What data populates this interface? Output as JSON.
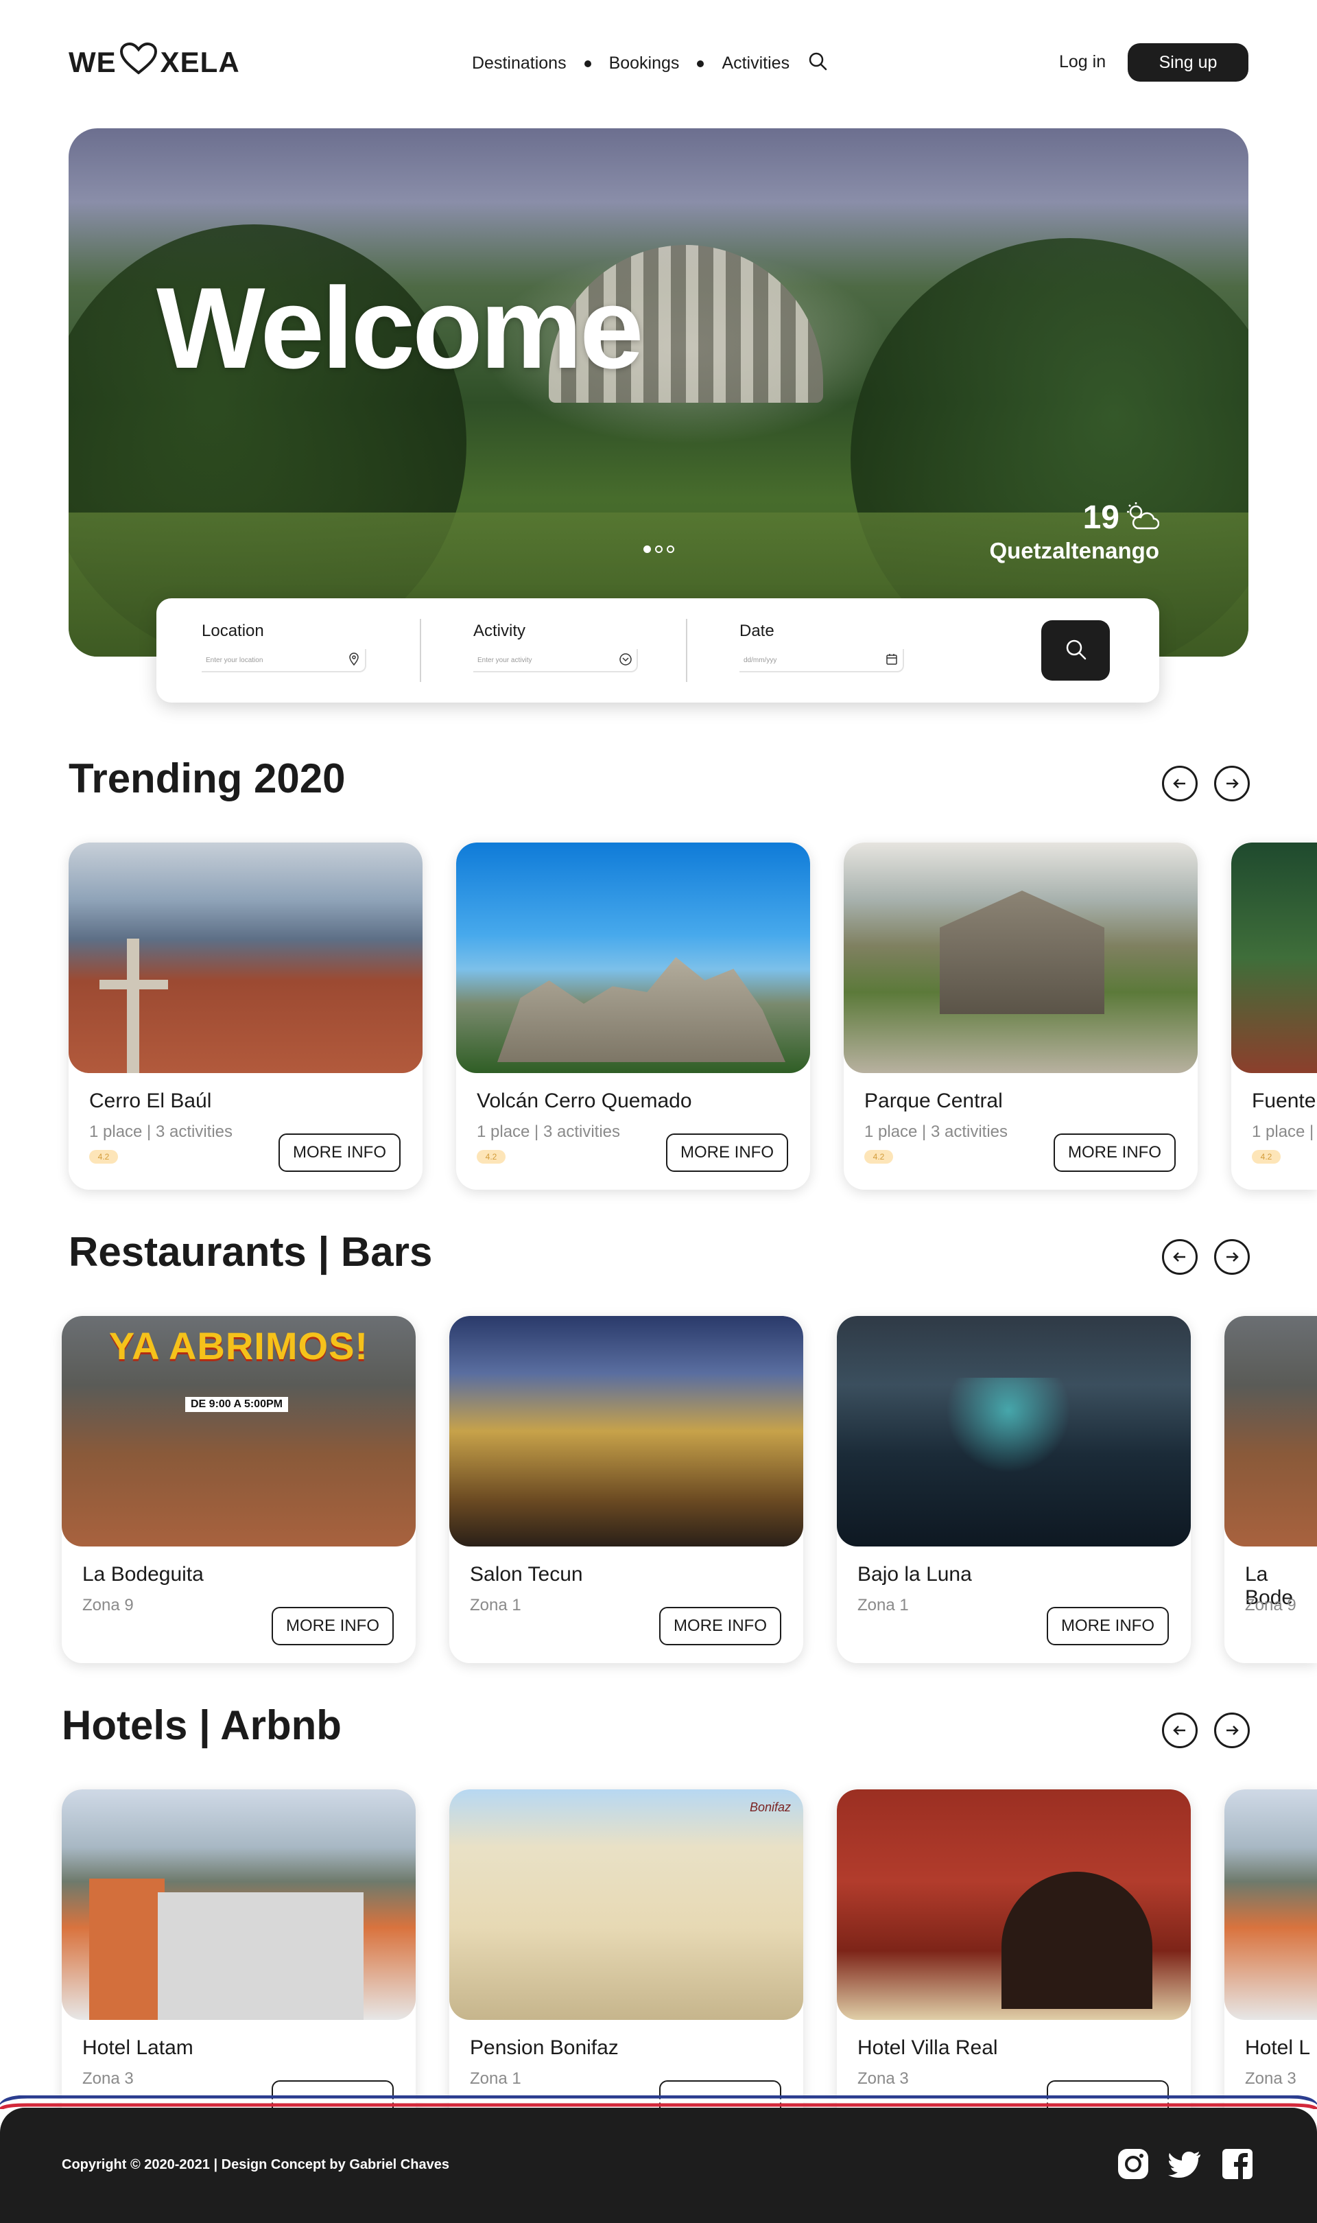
{
  "brand": {
    "prefix": "WE",
    "suffix": "XELA"
  },
  "nav": {
    "items": [
      "Destinations",
      "Bookings",
      "Activities"
    ]
  },
  "auth": {
    "login": "Log in",
    "signup": "Sing up"
  },
  "hero": {
    "title": "Welcome",
    "temperature": "19",
    "city": "Quetzaltenango",
    "slides": 3,
    "active_slide": 1
  },
  "search": {
    "location": {
      "label": "Location",
      "placeholder": "Enter your location"
    },
    "activity": {
      "label": "Activity",
      "placeholder": "Enter your activity"
    },
    "date": {
      "label": "Date",
      "placeholder": "dd/mm/yyy"
    }
  },
  "trending": {
    "title": "Trending 2020",
    "cards": [
      {
        "title": "Cerro El Baúl",
        "sub": "1 place | 3 activities",
        "rating": "4.2",
        "button": "MORE INFO"
      },
      {
        "title": "Volcán Cerro Quemado",
        "sub": "1 place | 3 activities",
        "rating": "4.2",
        "button": "MORE INFO"
      },
      {
        "title": "Parque Central",
        "sub": "1 place | 3 activities",
        "rating": "4.2",
        "button": "MORE INFO"
      },
      {
        "title": "Fuente",
        "sub": "1 place |",
        "rating": "4.2",
        "button": ""
      }
    ]
  },
  "restaurants": {
    "title": "Restaurants | Bars",
    "cards": [
      {
        "title": "La Bodeguita",
        "sub": "Zona 9",
        "button": "MORE INFO",
        "image_text": "YA ABRIMOS!",
        "image_hours": "DE 9:00 A 5:00PM"
      },
      {
        "title": "Salon Tecun",
        "sub": "Zona 1",
        "button": "MORE INFO"
      },
      {
        "title": "Bajo la Luna",
        "sub": "Zona 1",
        "button": "MORE INFO"
      },
      {
        "title": "La Bode",
        "sub": "Zona 9",
        "button": ""
      }
    ]
  },
  "hotels": {
    "title": "Hotels | Arbnb",
    "cards": [
      {
        "title": "Hotel Latam",
        "sub": "Zona 3"
      },
      {
        "title": "Pension Bonifaz",
        "sub": "Zona 1",
        "image_sign": "Bonifaz"
      },
      {
        "title": "Hotel Villa Real",
        "sub": "Zona 3"
      },
      {
        "title": "Hotel L",
        "sub": "Zona 3"
      }
    ]
  },
  "footer": {
    "copyright": "Copyright © 2020-2021 | Design Concept by Gabriel Chaves",
    "social": [
      "instagram-icon",
      "twitter-icon",
      "facebook-icon"
    ],
    "stripe_colors": [
      "#2b3d8f",
      "#ffffff",
      "#d3283a"
    ]
  }
}
